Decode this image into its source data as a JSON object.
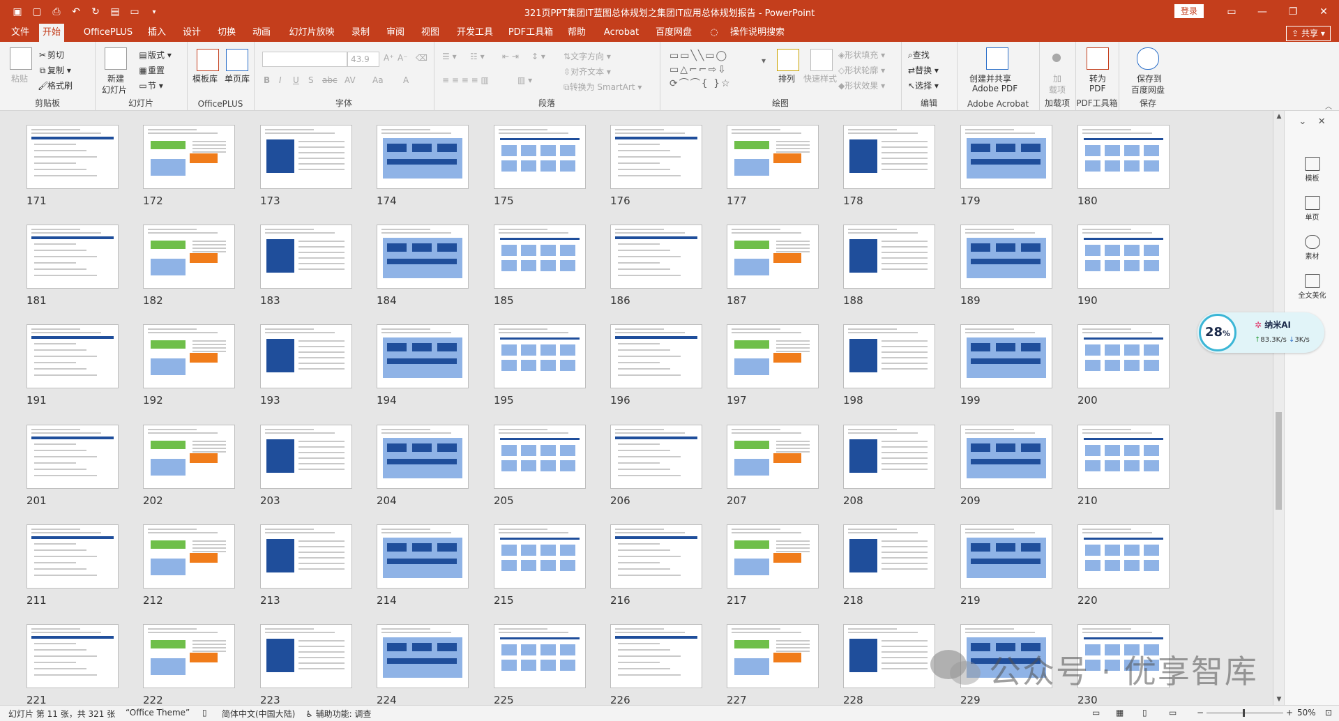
{
  "window": {
    "title": "321页PPT集团IT蓝图总体规划之集团IT应用总体规划报告 - PowerPoint",
    "login_label": "登录",
    "share_label": "共享",
    "controls": [
      "restore-ribbon",
      "minimize",
      "maximize",
      "close"
    ]
  },
  "tabs": [
    "文件",
    "开始",
    "OfficePLUS",
    "插入",
    "设计",
    "切换",
    "动画",
    "幻灯片放映",
    "录制",
    "审阅",
    "视图",
    "开发工具",
    "PDF工具箱",
    "帮助",
    "Acrobat",
    "百度网盘",
    "操作说明搜索"
  ],
  "active_tab": "开始",
  "ribbon": {
    "clipboard": {
      "paste": "粘贴",
      "cut": "剪切",
      "copy": "复制",
      "format_painter": "格式刷",
      "label": "剪贴板"
    },
    "slides": {
      "new_slide_line1": "新建",
      "new_slide_line2": "幻灯片",
      "layout": "版式",
      "reset": "重置",
      "section": "节",
      "label": "幻灯片"
    },
    "officeplus": {
      "template": "模板库",
      "single": "单页库",
      "label": "OfficePLUS"
    },
    "font": {
      "size": "43.9",
      "label": "字体",
      "bold": "B",
      "italic": "I",
      "underline": "U",
      "shadow": "S",
      "strike": "abc",
      "spacing": "AV",
      "case": "Aa",
      "color": "A"
    },
    "paragraph": {
      "text_direction": "文字方向",
      "align_text": "对齐文本",
      "smartart": "转换为 SmartArt",
      "label": "段落"
    },
    "drawing": {
      "arrange": "排列",
      "quick_styles": "快速样式",
      "fill": "形状填充",
      "outline": "形状轮廓",
      "effects": "形状效果",
      "label": "绘图"
    },
    "editing": {
      "find": "查找",
      "replace": "替换",
      "select": "选择",
      "label": "编辑"
    },
    "adobe": {
      "create_line1": "创建并共享",
      "create_line2": "Adobe PDF",
      "label": "Adobe Acrobat"
    },
    "addins": {
      "line1": "加",
      "line2": "载项",
      "label": "加载项"
    },
    "pdf": {
      "line1": "转为",
      "line2": "PDF",
      "label": "PDF工具箱"
    },
    "save": {
      "line1": "保存到",
      "line2": "百度网盘",
      "label": "保存"
    }
  },
  "slides": [
    "171",
    "172",
    "173",
    "174",
    "175",
    "176",
    "177",
    "178",
    "179",
    "180",
    "181",
    "182",
    "183",
    "184",
    "185",
    "186",
    "187",
    "188",
    "189",
    "190",
    "191",
    "192",
    "193",
    "194",
    "195",
    "196",
    "197",
    "198",
    "199",
    "200",
    "201",
    "202",
    "203",
    "204",
    "205",
    "206",
    "207",
    "208",
    "209",
    "210",
    "211",
    "212",
    "213",
    "214",
    "215",
    "216",
    "217",
    "218",
    "219",
    "220",
    "221",
    "222",
    "223",
    "224",
    "225",
    "226",
    "227",
    "228",
    "229",
    "230"
  ],
  "side_panel": {
    "items": [
      "模板",
      "单页",
      "素材",
      "全文美化"
    ]
  },
  "ai_widget": {
    "percent": "28",
    "percent_unit": "%",
    "name": "纳米AI",
    "upload": "83.3K/s",
    "download": "3K/s"
  },
  "watermark": {
    "text": "公众号 · 优享智库"
  },
  "status": {
    "slide_info": "幻灯片 第 11 张，共 321 张",
    "theme": "“Office Theme”",
    "language": "简体中文(中国大陆)",
    "accessibility": "辅助功能: 调查",
    "zoom": "50%"
  }
}
